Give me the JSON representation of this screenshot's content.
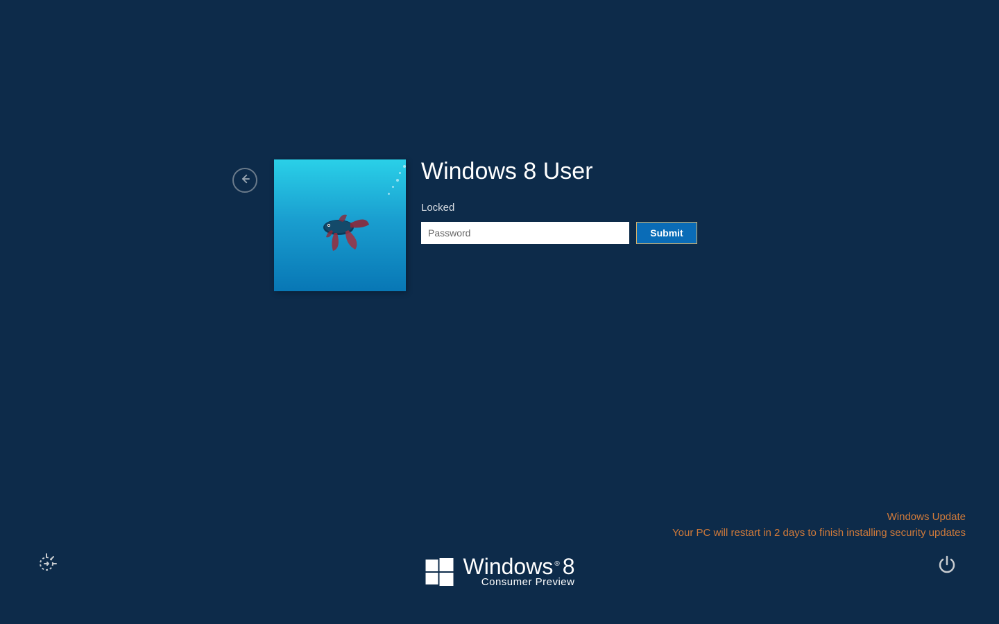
{
  "login": {
    "username": "Windows 8 User",
    "status": "Locked",
    "password_placeholder": "Password",
    "submit_label": "Submit"
  },
  "update_notice": {
    "title": "Windows Update",
    "message": "Your PC will restart in 2 days to finish installing security updates"
  },
  "brand": {
    "name": "Windows",
    "version": "8",
    "subtitle": "Consumer Preview"
  },
  "colors": {
    "background": "#0d2b4a",
    "accent_button": "#0a6cb7",
    "accent_border": "#d9b36b",
    "notice": "#d07a3a"
  },
  "icons": {
    "back": "arrow-left-icon",
    "ease_of_access": "ease-of-access-icon",
    "power": "power-icon",
    "windows_logo": "windows-logo-icon"
  }
}
